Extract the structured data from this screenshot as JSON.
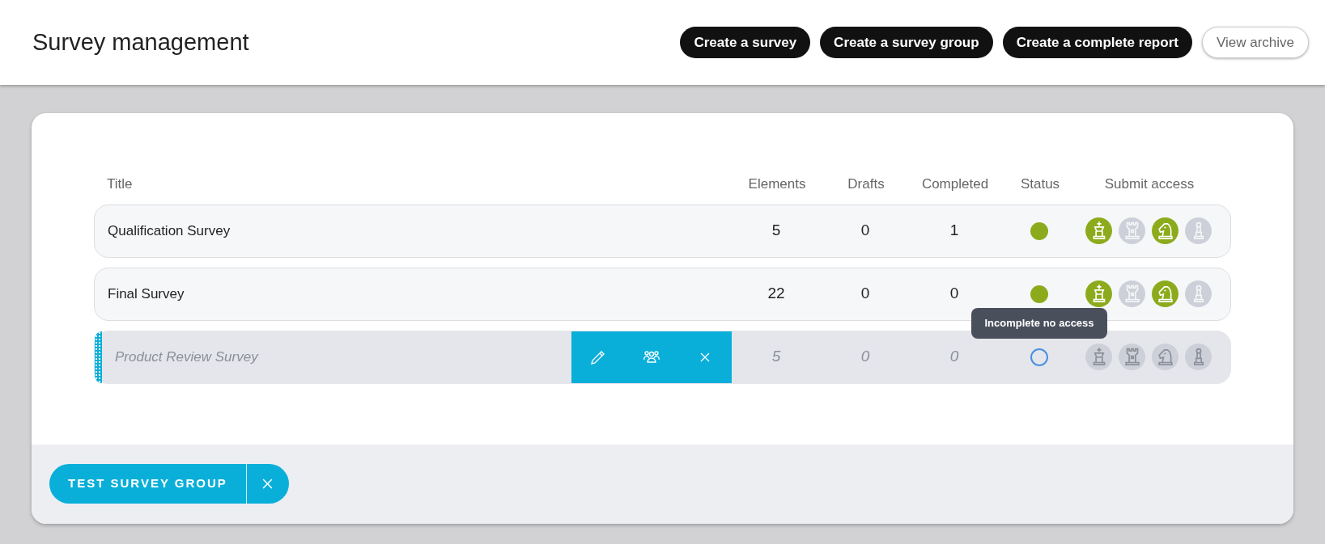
{
  "header": {
    "title": "Survey management",
    "buttons": [
      {
        "label": "Create a survey",
        "kind": "primary"
      },
      {
        "label": "Create a survey group",
        "kind": "primary"
      },
      {
        "label": "Create a complete report",
        "kind": "primary"
      },
      {
        "label": "View archive",
        "kind": "secondary"
      }
    ]
  },
  "table": {
    "columns": [
      "Title",
      "Elements",
      "Drafts",
      "Completed",
      "Status",
      "Submit access"
    ],
    "rows": [
      {
        "title": "Qualification Survey",
        "elements": "5",
        "drafts": "0",
        "completed": "1",
        "complete": true,
        "selected": false,
        "access": [
          {
            "kind": "king",
            "on": true
          },
          {
            "kind": "rook",
            "on": false
          },
          {
            "kind": "knight",
            "on": true
          },
          {
            "kind": "pawn",
            "on": false
          }
        ]
      },
      {
        "title": "Final Survey",
        "elements": "22",
        "drafts": "0",
        "completed": "0",
        "complete": true,
        "selected": false,
        "access": [
          {
            "kind": "king",
            "on": true
          },
          {
            "kind": "rook",
            "on": false
          },
          {
            "kind": "knight",
            "on": true
          },
          {
            "kind": "pawn",
            "on": false
          }
        ]
      },
      {
        "title": "Product Review Survey",
        "elements": "5",
        "drafts": "0",
        "completed": "0",
        "complete": false,
        "selected": true,
        "tooltip": "Incomplete no access",
        "access": [
          {
            "kind": "king",
            "on": false
          },
          {
            "kind": "rook",
            "on": false
          },
          {
            "kind": "knight",
            "on": false
          },
          {
            "kind": "pawn",
            "on": false
          }
        ]
      }
    ]
  },
  "group_chip": {
    "label": "TEST SURVEY GROUP"
  }
}
